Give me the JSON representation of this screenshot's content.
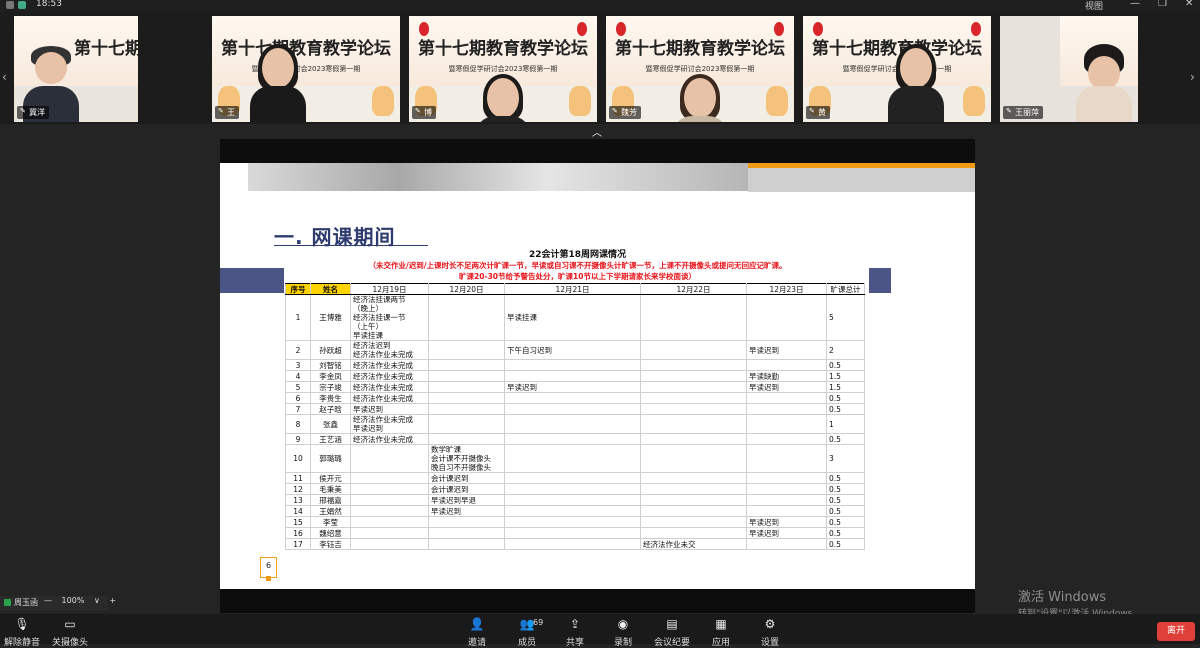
{
  "topbar": {
    "time": "18:53",
    "view_label": "视图",
    "win_controls": [
      "—",
      "❐",
      "✕"
    ]
  },
  "strip": {
    "banner_title": "第十七期教育教学论坛",
    "banner_sub": "暨寒假促学研讨会2023寒假第一期",
    "tiles": [
      {
        "name": "冀洋"
      },
      {
        "name": "王"
      },
      {
        "name": "博"
      },
      {
        "name": "魏芳"
      },
      {
        "name": "黄"
      },
      {
        "name": "王丽萍"
      }
    ],
    "collapse_icon": "chevron-up-icon"
  },
  "slide": {
    "section_title": "一. 网课期间",
    "table_title": "22会计第18周网课情况",
    "note_line1": "（未交作业/迟到/上课时长不足两次计旷课一节，早读或自习课不开摄像头计旷课一节，上课不开摄像头或提问无回应记旷课。",
    "note_line2": "旷课20-30节给予警告处分，旷课10节以上下学期请家长来学校面谈）",
    "headers": [
      "序号",
      "姓名",
      "12月19日",
      "12月20日",
      "12月21日",
      "12月22日",
      "12月23日",
      "旷课总计"
    ],
    "rows": [
      [
        "1",
        "王博雅",
        "经济法挂课两节\n（晚上）\n经济法挂课一节\n（上午）\n早读挂课",
        "",
        "早读挂课",
        "",
        "",
        "5"
      ],
      [
        "2",
        "孙跃超",
        "经济法迟到\n经济法作业未完成",
        "",
        "下午自习迟到",
        "",
        "早读迟到",
        "2"
      ],
      [
        "3",
        "刘智铭",
        "经济法作业未完成",
        "",
        "",
        "",
        "",
        "0.5"
      ],
      [
        "4",
        "李金凤",
        "经济法作业未完成",
        "",
        "",
        "",
        "早读缺勤",
        "1.5"
      ],
      [
        "5",
        "宗子竣",
        "经济法作业未完成",
        "",
        "早读迟到",
        "",
        "早读迟到",
        "1.5"
      ],
      [
        "6",
        "李贵生",
        "经济法作业未完成",
        "",
        "",
        "",
        "",
        "0.5"
      ],
      [
        "7",
        "赵子晗",
        "早读迟到",
        "",
        "",
        "",
        "",
        "0.5"
      ],
      [
        "8",
        "张鑫",
        "经济法作业未完成\n早读迟到",
        "",
        "",
        "",
        "",
        "1"
      ],
      [
        "9",
        "王艺涵",
        "经济法作业未完成",
        "",
        "",
        "",
        "",
        "0.5"
      ],
      [
        "10",
        "郭璐璐",
        "",
        "数学旷课\n会计课不开摄像头\n晚自习不开摄像头",
        "",
        "",
        "",
        "3"
      ],
      [
        "11",
        "侯开元",
        "",
        "会计课迟到",
        "",
        "",
        "",
        "0.5"
      ],
      [
        "12",
        "毛秉美",
        "",
        "会计课迟到",
        "",
        "",
        "",
        "0.5"
      ],
      [
        "13",
        "邢福嘉",
        "",
        "早读迟到早退",
        "",
        "",
        "",
        "0.5"
      ],
      [
        "14",
        "王娟然",
        "",
        "早读迟到",
        "",
        "",
        "",
        "0.5"
      ],
      [
        "15",
        "李莹",
        "",
        "",
        "",
        "",
        "早读迟到",
        "0.5"
      ],
      [
        "16",
        "魏绍意",
        "",
        "",
        "",
        "",
        "早读迟到",
        "0.5"
      ],
      [
        "17",
        "李钰吉",
        "",
        "",
        "",
        "经济法作业未交",
        "",
        "0.5"
      ]
    ],
    "page_number": "6"
  },
  "self_view": {
    "name": "周玉函"
  },
  "zoom": {
    "minus": "—",
    "value": "100%",
    "caret": "∨",
    "plus": "+"
  },
  "watermark": {
    "line1": "激活 Windows",
    "line2": "转到\"设置\"以激活 Windows。"
  },
  "toolbar": {
    "mic_label": "解除静音",
    "cam_label": "关摄像头",
    "invite_label": "邀请",
    "members_label": "成员",
    "members_count": "69",
    "share_label": "共享",
    "record_label": "录制",
    "minutes_label": "会议纪要",
    "apps_label": "应用",
    "settings_label": "设置",
    "leave_label": "离开"
  },
  "colors": {
    "accent_orange": "#f09a15",
    "navy": "#4a5586",
    "note_red": "#e8151c",
    "leave_red": "#e0403a",
    "header_yellow": "#ffd400"
  }
}
